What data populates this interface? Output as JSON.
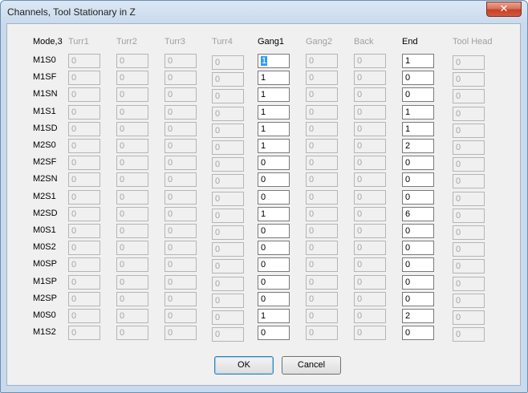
{
  "window": {
    "title": "Channels, Tool Stationary in Z",
    "close_glyph": "✕"
  },
  "grid": {
    "mode_label": "Mode,3",
    "columns": [
      {
        "label": "Turr1",
        "enabled": false
      },
      {
        "label": "Turr2",
        "enabled": false
      },
      {
        "label": "Turr3",
        "enabled": false
      },
      {
        "label": "Turr4",
        "enabled": false
      },
      {
        "label": "Gang1",
        "enabled": true
      },
      {
        "label": "Gang2",
        "enabled": false
      },
      {
        "label": "Back",
        "enabled": false
      },
      {
        "label": "End",
        "enabled": true
      },
      {
        "label": "Tool Head",
        "enabled": false
      }
    ],
    "rows": [
      {
        "label": "M1S0",
        "values": [
          "0",
          "0",
          "0",
          "0",
          "1",
          "0",
          "0",
          "1",
          "0"
        ]
      },
      {
        "label": "M1SF",
        "values": [
          "0",
          "0",
          "0",
          "0",
          "1",
          "0",
          "0",
          "0",
          "0"
        ]
      },
      {
        "label": "M1SN",
        "values": [
          "0",
          "0",
          "0",
          "0",
          "1",
          "0",
          "0",
          "0",
          "0"
        ]
      },
      {
        "label": "M1S1",
        "values": [
          "0",
          "0",
          "0",
          "0",
          "1",
          "0",
          "0",
          "1",
          "0"
        ]
      },
      {
        "label": "M1SD",
        "values": [
          "0",
          "0",
          "0",
          "0",
          "1",
          "0",
          "0",
          "1",
          "0"
        ]
      },
      {
        "label": "M2S0",
        "values": [
          "0",
          "0",
          "0",
          "0",
          "1",
          "0",
          "0",
          "2",
          "0"
        ]
      },
      {
        "label": "M2SF",
        "values": [
          "0",
          "0",
          "0",
          "0",
          "0",
          "0",
          "0",
          "0",
          "0"
        ]
      },
      {
        "label": "M2SN",
        "values": [
          "0",
          "0",
          "0",
          "0",
          "0",
          "0",
          "0",
          "0",
          "0"
        ]
      },
      {
        "label": "M2S1",
        "values": [
          "0",
          "0",
          "0",
          "0",
          "0",
          "0",
          "0",
          "0",
          "0"
        ]
      },
      {
        "label": "M2SD",
        "values": [
          "0",
          "0",
          "0",
          "0",
          "1",
          "0",
          "0",
          "6",
          "0"
        ]
      },
      {
        "label": "M0S1",
        "values": [
          "0",
          "0",
          "0",
          "0",
          "0",
          "0",
          "0",
          "0",
          "0"
        ]
      },
      {
        "label": "M0S2",
        "values": [
          "0",
          "0",
          "0",
          "0",
          "0",
          "0",
          "0",
          "0",
          "0"
        ]
      },
      {
        "label": "M0SP",
        "values": [
          "0",
          "0",
          "0",
          "0",
          "0",
          "0",
          "0",
          "0",
          "0"
        ]
      },
      {
        "label": "M1SP",
        "values": [
          "0",
          "0",
          "0",
          "0",
          "0",
          "0",
          "0",
          "0",
          "0"
        ]
      },
      {
        "label": "M2SP",
        "values": [
          "0",
          "0",
          "0",
          "0",
          "0",
          "0",
          "0",
          "0",
          "0"
        ]
      },
      {
        "label": "M0S0",
        "values": [
          "0",
          "0",
          "0",
          "0",
          "1",
          "0",
          "0",
          "2",
          "0"
        ]
      },
      {
        "label": "M1S2",
        "values": [
          "0",
          "0",
          "0",
          "0",
          "0",
          "0",
          "0",
          "0",
          "0"
        ]
      }
    ],
    "selected_cell": {
      "row": 0,
      "col": 4
    }
  },
  "buttons": {
    "ok_label": "OK",
    "cancel_label": "Cancel"
  }
}
